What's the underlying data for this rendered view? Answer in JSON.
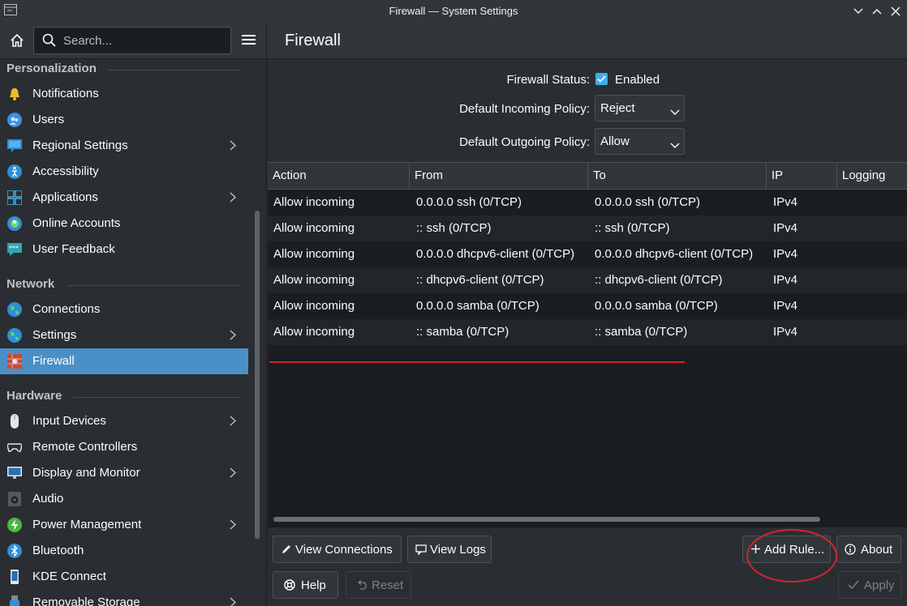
{
  "window": {
    "title": "Firewall — System Settings"
  },
  "search": {
    "placeholder": "Search..."
  },
  "sidebar": {
    "sections": [
      {
        "title": "Personalization",
        "items": [
          {
            "label": "Notifications",
            "icon": "bell-icon",
            "chevron": false
          },
          {
            "label": "Users",
            "icon": "users-icon",
            "chevron": false
          },
          {
            "label": "Regional Settings",
            "icon": "regional-icon",
            "chevron": true
          },
          {
            "label": "Accessibility",
            "icon": "accessibility-icon",
            "chevron": false
          },
          {
            "label": "Applications",
            "icon": "applications-icon",
            "chevron": true
          },
          {
            "label": "Online Accounts",
            "icon": "online-accounts-icon",
            "chevron": false
          },
          {
            "label": "User Feedback",
            "icon": "feedback-icon",
            "chevron": false
          }
        ]
      },
      {
        "title": "Network",
        "items": [
          {
            "label": "Connections",
            "icon": "globe-icon",
            "chevron": false
          },
          {
            "label": "Settings",
            "icon": "globe-icon",
            "chevron": true
          },
          {
            "label": "Firewall",
            "icon": "firewall-icon",
            "chevron": false,
            "selected": true
          }
        ]
      },
      {
        "title": "Hardware",
        "items": [
          {
            "label": "Input Devices",
            "icon": "mouse-icon",
            "chevron": true
          },
          {
            "label": "Remote Controllers",
            "icon": "gamepad-icon",
            "chevron": false
          },
          {
            "label": "Display and Monitor",
            "icon": "monitor-icon",
            "chevron": true
          },
          {
            "label": "Audio",
            "icon": "speaker-icon",
            "chevron": false
          },
          {
            "label": "Power Management",
            "icon": "power-icon",
            "chevron": true
          },
          {
            "label": "Bluetooth",
            "icon": "bluetooth-icon",
            "chevron": false
          },
          {
            "label": "KDE Connect",
            "icon": "kde-connect-icon",
            "chevron": false
          },
          {
            "label": "Removable Storage",
            "icon": "usb-icon",
            "chevron": true
          }
        ]
      }
    ]
  },
  "page": {
    "title": "Firewall",
    "status_label": "Firewall Status:",
    "status_value": "Enabled",
    "status_checked": true,
    "incoming_label": "Default Incoming Policy:",
    "incoming_value": "Reject",
    "outgoing_label": "Default Outgoing Policy:",
    "outgoing_value": "Allow"
  },
  "table": {
    "columns": [
      "Action",
      "From",
      "To",
      "IP",
      "Logging"
    ],
    "rows": [
      [
        "Allow incoming",
        "0.0.0.0 ssh (0/TCP)",
        "0.0.0.0 ssh (0/TCP)",
        "IPv4",
        ""
      ],
      [
        "Allow incoming",
        ":: ssh (0/TCP)",
        ":: ssh (0/TCP)",
        "IPv4",
        ""
      ],
      [
        "Allow incoming",
        "0.0.0.0 dhcpv6-client (0/TCP)",
        "0.0.0.0 dhcpv6-client (0/TCP)",
        "IPv4",
        ""
      ],
      [
        "Allow incoming",
        ":: dhcpv6-client (0/TCP)",
        ":: dhcpv6-client (0/TCP)",
        "IPv4",
        ""
      ],
      [
        "Allow incoming",
        "0.0.0.0 samba (0/TCP)",
        "0.0.0.0 samba (0/TCP)",
        "IPv4",
        ""
      ],
      [
        "Allow incoming",
        ":: samba (0/TCP)",
        ":: samba (0/TCP)",
        "IPv4",
        ""
      ]
    ]
  },
  "buttons": {
    "view_connections": "View Connections",
    "view_logs": "View Logs",
    "add_rule": "Add Rule...",
    "about": "About",
    "help": "Help",
    "reset": "Reset",
    "apply": "Apply"
  },
  "colors": {
    "accent": "#3daee9",
    "selection": "#4a90c6",
    "annotation": "#d2242f"
  }
}
